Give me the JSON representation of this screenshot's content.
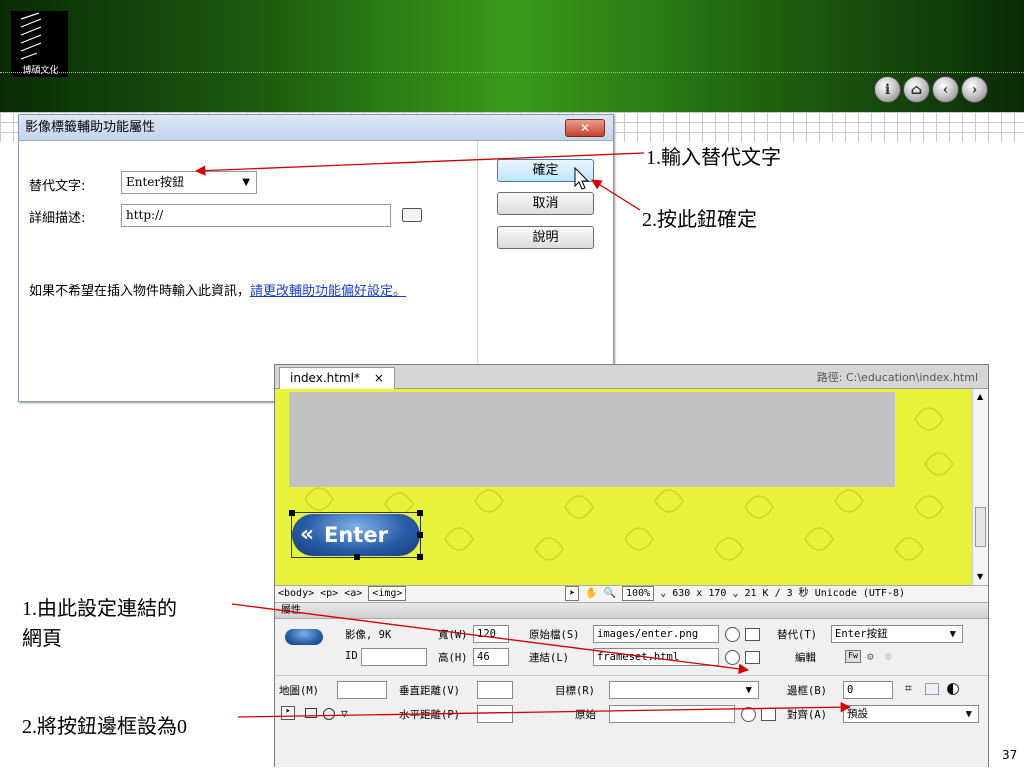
{
  "banner": {
    "logo_text": "博碩文化",
    "nav_icons": [
      "info-icon",
      "home-icon",
      "back-icon",
      "forward-icon"
    ]
  },
  "dialog": {
    "title": "影像標籤輔助功能屬性",
    "close_label": "✕",
    "alt_label": "替代文字:",
    "alt_value": "Enter按鈕",
    "desc_label": "詳細描述:",
    "desc_value": "http://",
    "info_text": "如果不希望在插入物件時輸入此資訊，",
    "info_link": "請更改輔助功能偏好設定。",
    "ok_label": "確定",
    "cancel_label": "取消",
    "help_label": "說明"
  },
  "annotations": {
    "a1": "1.輸入替代文字",
    "a2": "2.按此鈕確定",
    "a3_line1": "1.由此設定連結的",
    "a3_line2": "網頁",
    "a4": "2.將按鈕邊框設為0"
  },
  "editor": {
    "tab_label": "index.html*",
    "tab_close": "×",
    "path": "路徑: C:\\education\\index.html",
    "button_text": "Enter",
    "tag_selector": "<body> <p> <a>",
    "tag_selected": "<img>",
    "zoom": "100%",
    "size_info": "630 x 170",
    "file_info": "21 K / 3 秒",
    "encoding": "Unicode (UTF-8)"
  },
  "properties": {
    "panel_label": "屬性",
    "image_info": "影像, 9K",
    "id_label": "ID",
    "id_value": "",
    "width_label": "寬(W)",
    "width_value": "120",
    "height_label": "高(H)",
    "height_value": "46",
    "src_label": "原始檔(S)",
    "src_value": "images/enter.png",
    "link_label": "連結(L)",
    "link_value": "frameset.html",
    "alt_label": "替代(T)",
    "alt_value": "Enter按鈕",
    "edit_label": "編輯",
    "map_label": "地圖(M)",
    "map_value": "",
    "vspace_label": "垂直距離(V)",
    "vspace_value": "",
    "hspace_label": "水平距離(P)",
    "hspace_value": "",
    "target_label": "目標(R)",
    "target_value": "",
    "original_label": "原始",
    "original_value": "",
    "border_label": "邊框(B)",
    "border_value": "0",
    "align_label": "對齊(A)",
    "align_value": "預設"
  },
  "page_number": "37"
}
